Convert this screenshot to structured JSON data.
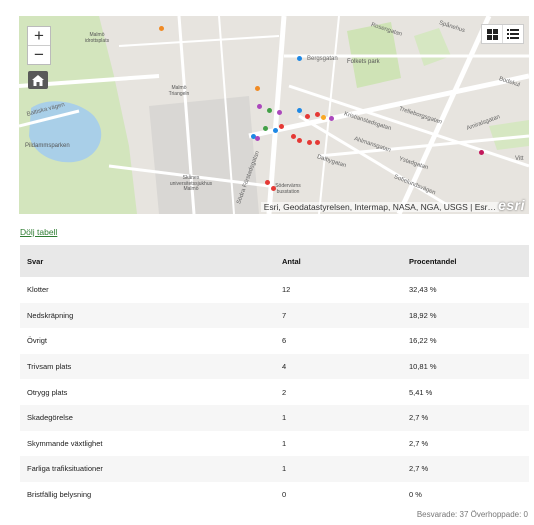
{
  "map": {
    "zoom_in": "+",
    "zoom_out": "−",
    "attribution": "Esri, Geodatastyrelsen, Intermap, NASA, NGA, USGS | Esr…",
    "logo": "esri",
    "labels": {
      "malmo_idrottsplats": "Malmö idrottsplats",
      "malmo_triangeln": "Malmö Triangeln",
      "pildammsparken": "Pildammsparken",
      "sjukhus": "Skånes universitetssjukhus Malmö",
      "sodervarn": "Södervärns busstation",
      "folkets_park": "Folkets park",
      "spanehus": "Spånehus",
      "rosengatan": "Rosengatan",
      "bergsgatan": "Bergsgatan",
      "kristianstadsgatan": "Kristianstadsgatan",
      "trelleborgsgatan": "Trelleborgsgatan",
      "amiralsgatan": "Amiralsgatan",
      "ystadgatan": "Ystadgatan",
      "sofielundsvagen": "Sofielundsvägen",
      "bodekul": "Bodekul",
      "ahlmansgatan": "Ahlmansgatan",
      "sodra_forstadsgatan": "Södra Förstadsgatan",
      "dalbygatan": "Dalbygatan",
      "bakerlag": "Baltiska vägen",
      "vitt": "Vitt"
    },
    "colors": {
      "park": "#cfe3b6",
      "water": "#a9cfe8",
      "road": "#ffffff",
      "land": "#e7e4df"
    }
  },
  "toggle_label": "Dölj tabell",
  "table": {
    "headers": [
      "Svar",
      "Antal",
      "Procentandel"
    ],
    "rows": [
      [
        "Klotter",
        "12",
        "32,43 %"
      ],
      [
        "Nedskräpning",
        "7",
        "18,92 %"
      ],
      [
        "Övrigt",
        "6",
        "16,22 %"
      ],
      [
        "Trivsam plats",
        "4",
        "10,81 %"
      ],
      [
        "Otrygg plats",
        "2",
        "5,41 %"
      ],
      [
        "Skadegörelse",
        "1",
        "2,7 %"
      ],
      [
        "Skymmande växtlighet",
        "1",
        "2,7 %"
      ],
      [
        "Farliga trafiksituationer",
        "1",
        "2,7 %"
      ],
      [
        "Bristfällig belysning",
        "0",
        "0 %"
      ]
    ]
  },
  "footer": "Besvarade: 37  Överhoppade: 0"
}
